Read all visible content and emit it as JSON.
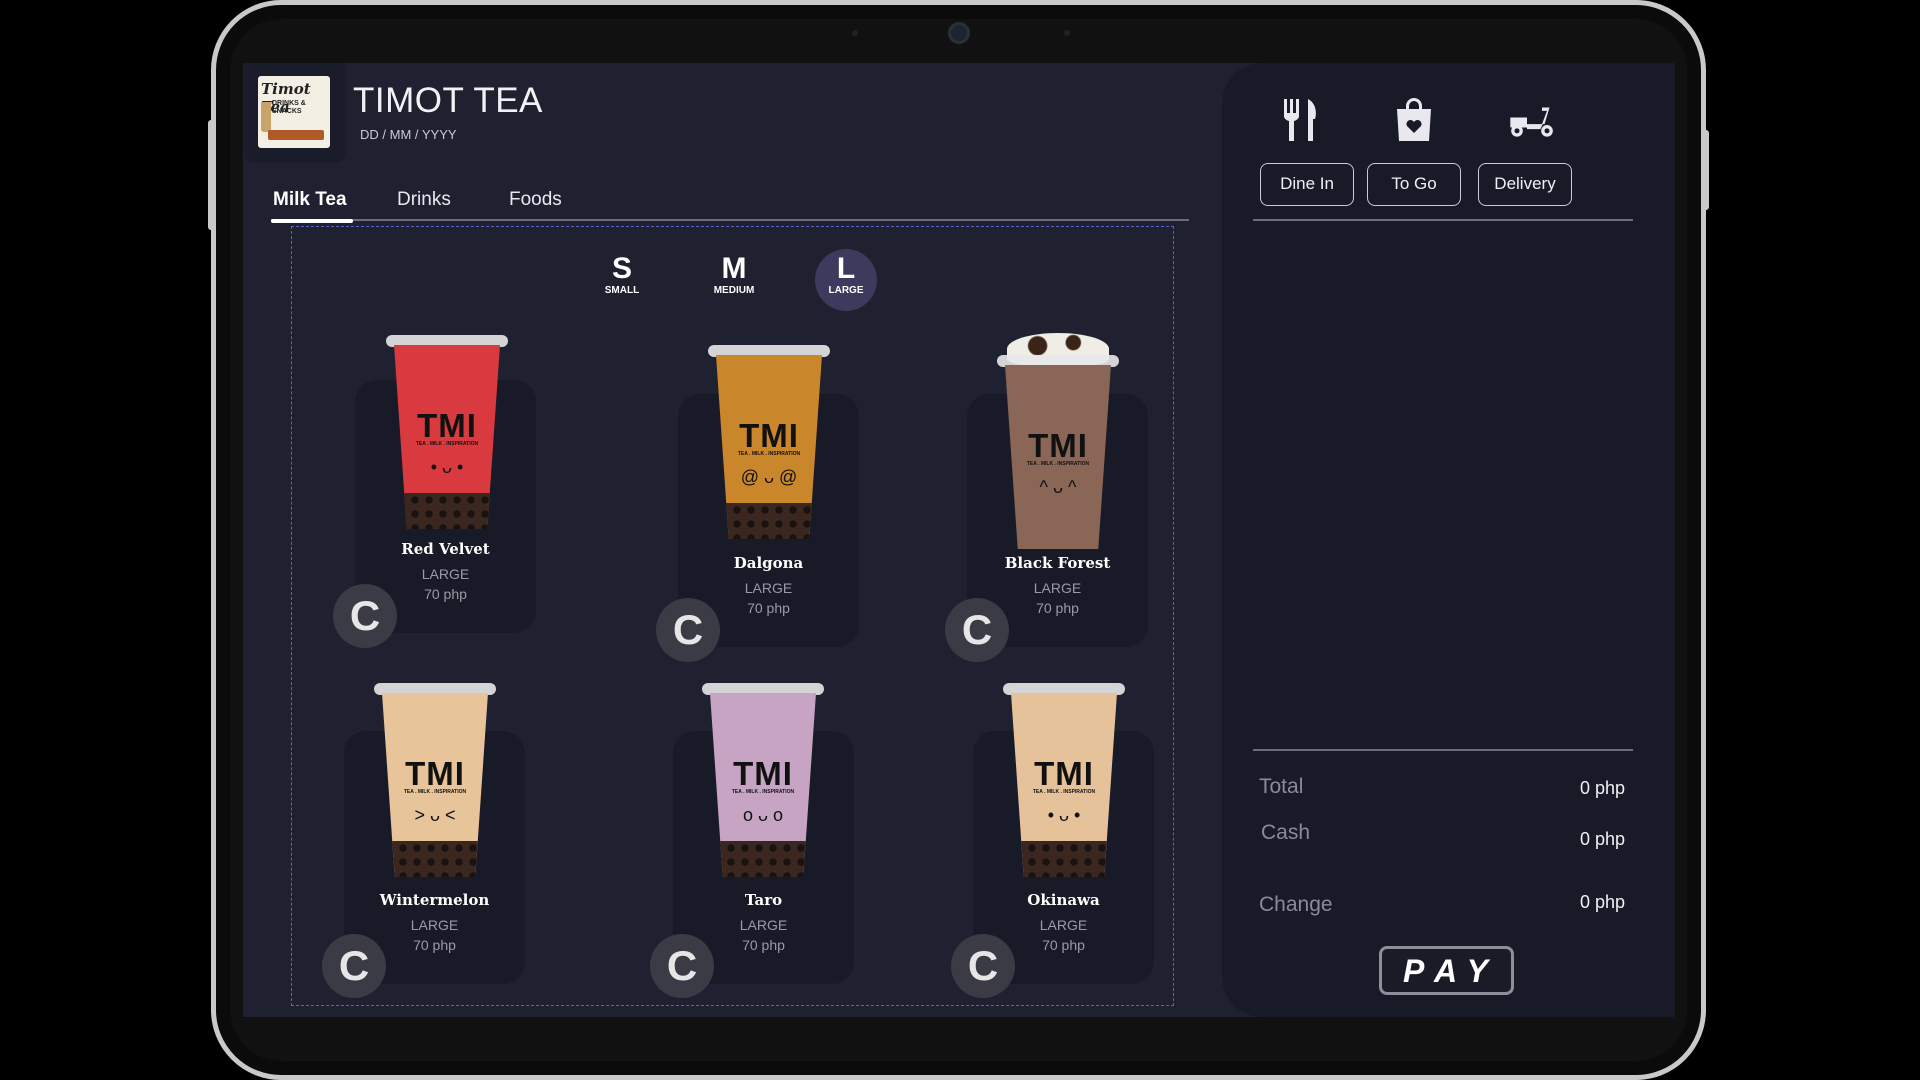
{
  "header": {
    "brand": "TIMOT TEA",
    "date_placeholder": "DD / MM / YYYY",
    "logo_text_line1": "Timot Tea",
    "logo_text_line2": "DRINKS &",
    "logo_text_line3": "SNACKS"
  },
  "tabs": [
    {
      "label": "Milk Tea",
      "active": true
    },
    {
      "label": "Drinks",
      "active": false
    },
    {
      "label": "Foods",
      "active": false
    }
  ],
  "sizes": [
    {
      "letter": "S",
      "label": "SMALL",
      "selected": false
    },
    {
      "letter": "M",
      "label": "MEDIUM",
      "selected": false
    },
    {
      "letter": "L",
      "label": "LARGE",
      "selected": true
    }
  ],
  "products": [
    {
      "name": "Red Velvet",
      "size": "LARGE",
      "price": "70 php",
      "color": "#d83a3f",
      "cup_text": "TMI",
      "cup_sub": "TEA . MILK . INSPIRATION"
    },
    {
      "name": "Dalgona",
      "size": "LARGE",
      "price": "70 php",
      "color": "#c9862a",
      "cup_text": "TMI",
      "cup_sub": "TEA . MILK . INSPIRATION"
    },
    {
      "name": "Black Forest",
      "size": "LARGE",
      "price": "70 php",
      "color": "#8a6656",
      "cup_text": "TMI",
      "cup_sub": "TEA . MILK . INSPIRATION"
    },
    {
      "name": "Wintermelon",
      "size": "LARGE",
      "price": "70 php",
      "color": "#e8c49a",
      "cup_text": "TMI",
      "cup_sub": "TEA . MILK . INSPIRATION"
    },
    {
      "name": "Taro",
      "size": "LARGE",
      "price": "70 php",
      "color": "#c7a4c4",
      "cup_text": "TMI",
      "cup_sub": "TEA . MILK . INSPIRATION"
    },
    {
      "name": "Okinawa",
      "size": "LARGE",
      "price": "70 php",
      "color": "#e6c29a",
      "cup_text": "TMI",
      "cup_sub": "TEA . MILK . INSPIRATION"
    }
  ],
  "customize_label": "C",
  "order": {
    "service_options": [
      {
        "label": "Dine In",
        "icon": "utensils-icon"
      },
      {
        "label": "To Go",
        "icon": "shopping-bag-icon"
      },
      {
        "label": "Delivery",
        "icon": "scooter-icon"
      }
    ],
    "total_label": "Total",
    "total_value": "0 php",
    "cash_label": "Cash",
    "cash_value": "0 php",
    "change_label": "Change",
    "change_value": "0 php",
    "pay_label": "PAY"
  }
}
